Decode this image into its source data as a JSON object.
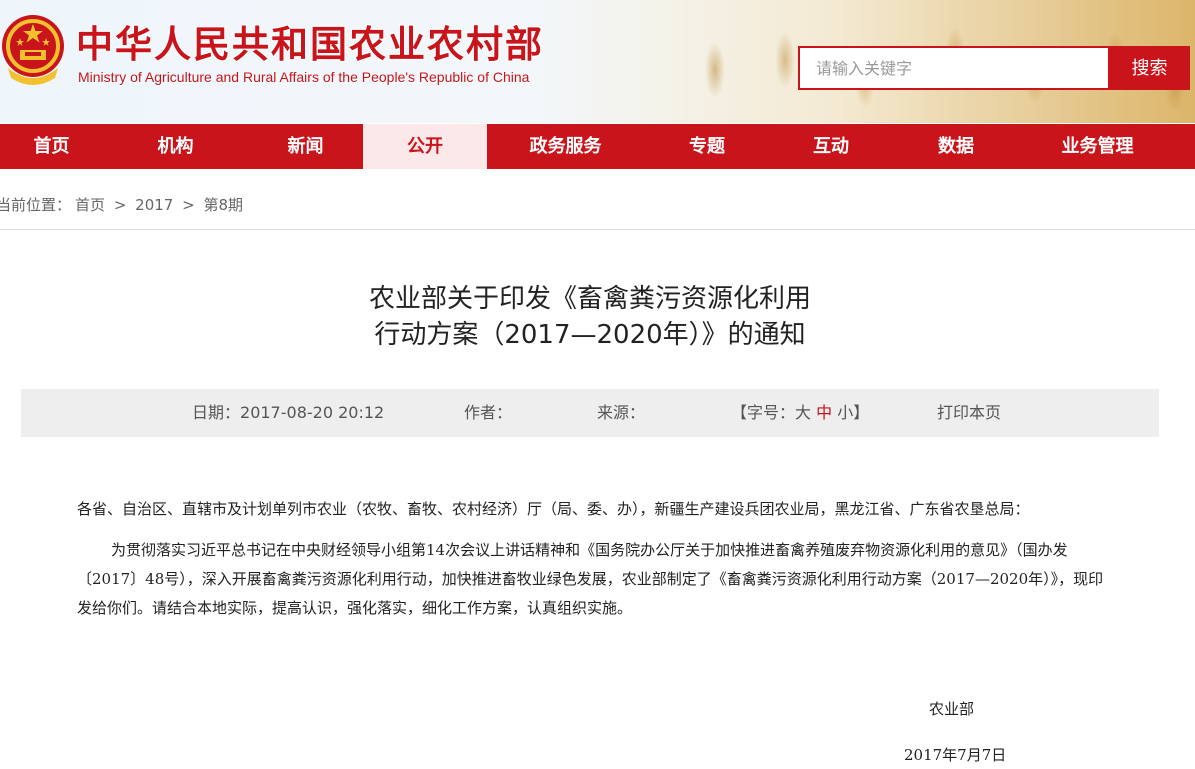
{
  "header": {
    "title": "中华人民共和国农业农村部",
    "subtitle": "Ministry of Agriculture and Rural Affairs of the People's Republic of China",
    "emblem_icon": "national-emblem-icon",
    "search_placeholder": "请输入关键字",
    "search_button": "搜索"
  },
  "nav": {
    "items": [
      {
        "label": "首页"
      },
      {
        "label": "机构"
      },
      {
        "label": "新闻"
      },
      {
        "label": "公开",
        "active": true
      },
      {
        "label": "政务服务"
      },
      {
        "label": "专题"
      },
      {
        "label": "互动"
      },
      {
        "label": "数据"
      },
      {
        "label": "业务管理"
      }
    ]
  },
  "breadcrumb": {
    "prefix": "当前位置：",
    "items": [
      "首页",
      "2017",
      "第8期"
    ],
    "separator": ">"
  },
  "article": {
    "title_line1": "农业部关于印发《畜禽粪污资源化利用",
    "title_line2": "行动方案（2017—2020年）》的通知",
    "meta": {
      "date_label": "日期：",
      "date_value": "2017-08-20 20:12",
      "author_label": "作者：",
      "source_label": "来源：",
      "font_open": "【字号：",
      "font_large": "大",
      "font_medium": "中",
      "font_small": "小",
      "font_close": "】",
      "print": "打印本页"
    },
    "para1": "各省、自治区、直辖市及计划单列市农业（农牧、畜牧、农村经济）厅（局、委、办），新疆生产建设兵团农业局，黑龙江省、广东省农垦总局：",
    "para2": "为贯彻落实习近平总书记在中央财经领导小组第14次会议上讲话精神和《国务院办公厅关于加快推进畜禽养殖废弃物资源化利用的意见》（国办发〔2017〕48号），深入开展畜禽粪污资源化利用行动，加快推进畜牧业绿色发展，农业部制定了《畜禽粪污资源化利用行动方案（2017—2020年）》，现印发给你们。请结合本地实际，提高认识，强化落实，细化工作方案，认真组织实施。",
    "signature_org": "农业部",
    "signature_date": "2017年7月7日"
  },
  "colors": {
    "brand_red": "#c8141a",
    "nav_active_bg": "#fbe9ea",
    "meta_bg": "#eeeeee"
  }
}
